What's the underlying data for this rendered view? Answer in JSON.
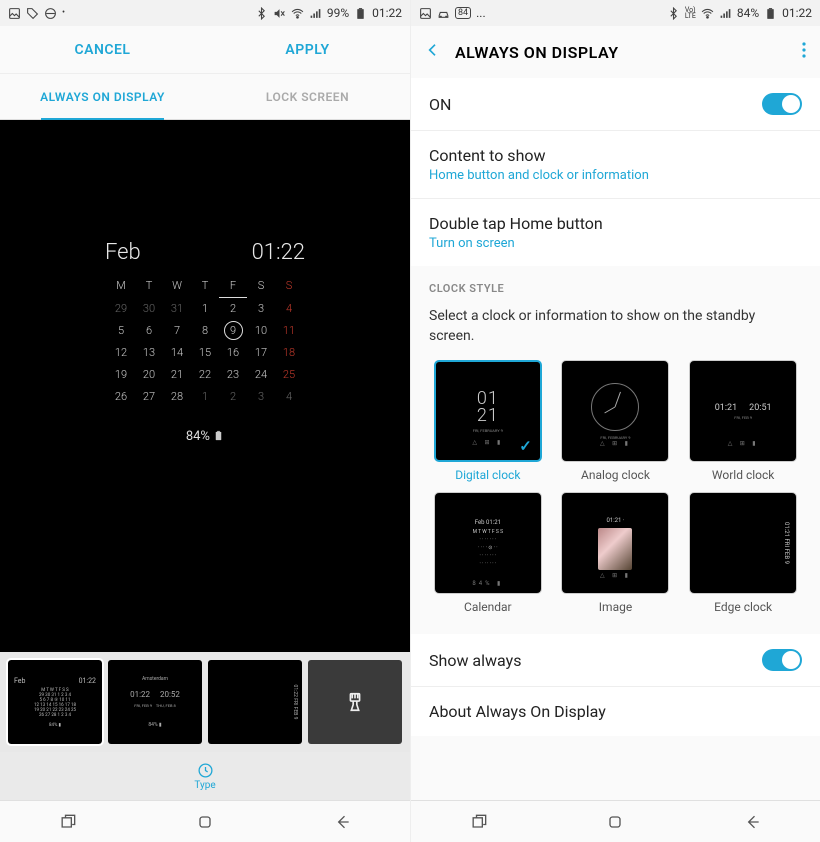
{
  "left": {
    "status": {
      "battery": "99%",
      "time": "01:22"
    },
    "cancel": "CANCEL",
    "apply": "APPLY",
    "tabs": {
      "aod": "ALWAYS ON DISPLAY",
      "lock": "LOCK SCREEN"
    },
    "preview": {
      "month": "Feb",
      "time": "01:22",
      "days": [
        "M",
        "T",
        "W",
        "T",
        "F",
        "S",
        "S"
      ],
      "weeks": [
        [
          "29",
          "30",
          "31",
          "1",
          "2",
          "3",
          "4"
        ],
        [
          "5",
          "6",
          "7",
          "8",
          "9",
          "10",
          "11"
        ],
        [
          "12",
          "13",
          "14",
          "15",
          "16",
          "17",
          "18"
        ],
        [
          "19",
          "20",
          "21",
          "22",
          "23",
          "24",
          "25"
        ],
        [
          "26",
          "27",
          "28",
          "1",
          "2",
          "3",
          "4"
        ]
      ],
      "today": "9",
      "battery": "84%"
    },
    "thumbs": {
      "t1": {
        "month": "Feb",
        "time": "01:22"
      },
      "t2": {
        "t1": "01:22",
        "t2": "20:52",
        "loc": "Amsterdam"
      }
    },
    "type_label": "Type"
  },
  "right": {
    "status": {
      "badge": "84",
      "battery": "84%",
      "time": "01:22"
    },
    "title": "ALWAYS ON DISPLAY",
    "on": "ON",
    "content": {
      "label": "Content to show",
      "sub": "Home button and clock or information"
    },
    "doubletap": {
      "label": "Double tap Home button",
      "sub": "Turn on screen"
    },
    "clockstyle": "CLOCK STYLE",
    "desc": "Select a clock or information to show on the standby screen.",
    "options": {
      "digital": "Digital clock",
      "analog": "Analog clock",
      "world": "World clock",
      "calendar": "Calendar",
      "image": "Image",
      "edge": "Edge clock"
    },
    "opt_content": {
      "dig_time1": "01",
      "dig_time2": "21",
      "dig_date": "FRI, FEBRUARY 9",
      "wc1": "01:21",
      "wc2": "20:51",
      "wc_date": "FRI, FEB 9",
      "cal_hdr": "Feb     01:21",
      "cal_body": "M T W T F S S",
      "img_time": "01:21",
      "edge_txt": "01:21  FRI FEB 9"
    },
    "show_always": "Show always",
    "about": "About Always On Display"
  }
}
